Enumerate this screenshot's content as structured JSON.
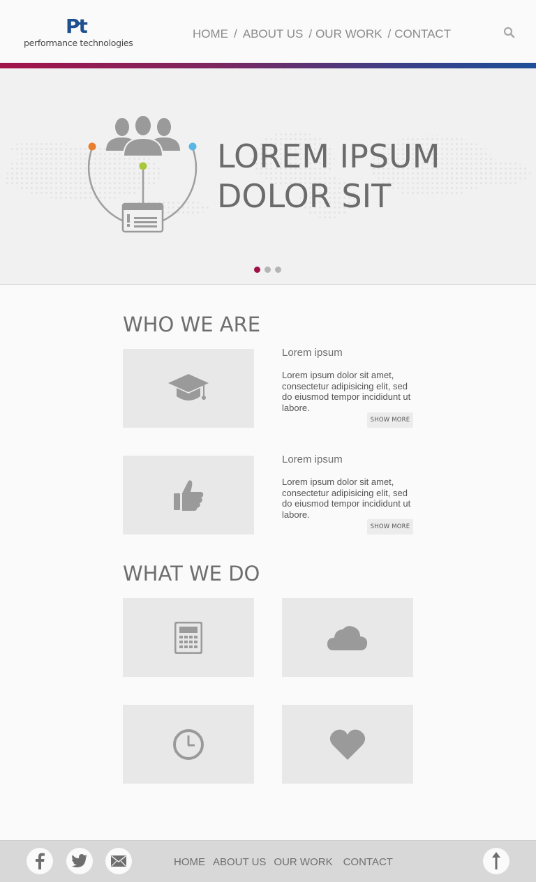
{
  "header": {
    "logo_mark": "Pt",
    "logo_text": "performance technologies",
    "nav": [
      "HOME",
      "ABOUT US",
      "OUR WORK",
      "CONTACT"
    ],
    "separator": "/",
    "search_icon": "search-icon"
  },
  "colors": {
    "brand_blue": "#1f4f8f",
    "accent_crimson": "#9e1247",
    "gradient_start": "#a3144a",
    "gradient_end": "#1d4f98",
    "dot_orange": "#e87e2e",
    "dot_green": "#a9c73a",
    "dot_blue": "#5bb6e3"
  },
  "hero": {
    "title_line1": "LOREM IPSUM",
    "title_line2": "DOLOR SIT",
    "slides": 3,
    "active_slide": 1,
    "icon": "people-network-icon"
  },
  "who_we_are": {
    "title": "WHO WE ARE",
    "items": [
      {
        "icon": "graduation-cap-icon",
        "title": "Lorem ipsum",
        "body": "Lorem ipsum dolor sit amet, consectetur adipisicing elit, sed do eiusmod tempor incididunt ut labore.",
        "button": "SHOW MORE"
      },
      {
        "icon": "thumbs-up-icon",
        "title": "Lorem ipsum",
        "body": "Lorem ipsum dolor sit amet, consectetur adipisicing elit, sed do eiusmod tempor incididunt ut labore.",
        "button": "SHOW MORE"
      }
    ]
  },
  "what_we_do": {
    "title": "WHAT WE DO",
    "tiles": [
      "calculator-icon",
      "cloud-icon",
      "clock-icon",
      "heart-icon"
    ]
  },
  "footer": {
    "social": [
      "facebook-icon",
      "twitter-icon",
      "mail-icon"
    ],
    "nav": [
      "HOME",
      "ABOUT US",
      "OUR WORK",
      "CONTACT"
    ],
    "back_to_top_icon": "arrow-up-icon"
  }
}
